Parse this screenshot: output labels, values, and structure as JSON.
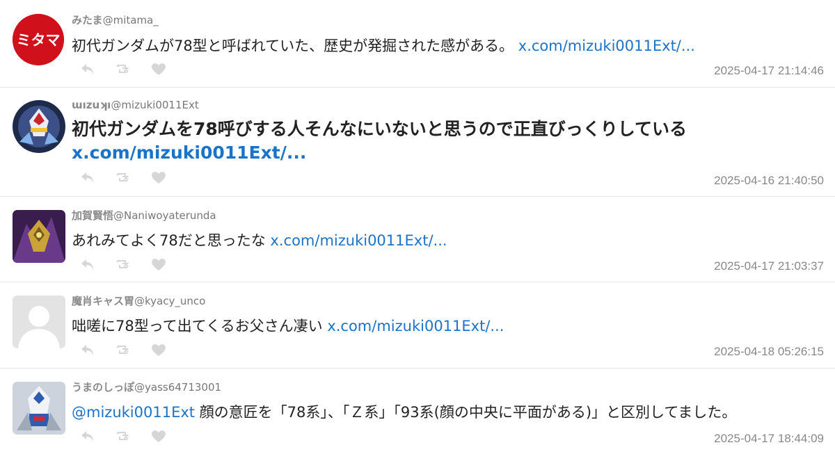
{
  "tweets": [
    {
      "name": "みたま",
      "handle": "@mitama_",
      "avatar_text": "ミタマ",
      "text": "初代ガンダムが78型と呼ばれていた、歴史が発掘された感がある。",
      "link": "x.com/mizuki0011Ext/...",
      "time": "2025-04-17 21:14:46"
    },
    {
      "name": "ɯızuʞı",
      "handle": "@mizuki0011Ext",
      "text": "初代ガンダムを78呼びする人そんなにいないと思うので正直びっくりしている",
      "link": "x.com/mizuki0011Ext/...",
      "time": "2025-04-16 21:40:50"
    },
    {
      "name": "加賀賢悟",
      "handle": "@Naniwoyaterunda",
      "text": "あれみてよく78だと思ったな",
      "link": "x.com/mizuki0011Ext/...",
      "time": "2025-04-17 21:03:37"
    },
    {
      "name": "魔肖キャス胃",
      "handle": "@kyacy_unco",
      "text": "咄嗟に78型って出てくるお父さん凄い",
      "link": "x.com/mizuki0011Ext/...",
      "time": "2025-04-18 05:26:15"
    },
    {
      "name": "うまのしっぽ",
      "handle": "@yass64713001",
      "mention": "@mizuki0011Ext",
      "text": "顔の意匠を「78系」、「Ｚ系」「93系(顔の中央に平面がある)」と区別してました。",
      "time": "2025-04-17 18:44:09"
    }
  ],
  "icons": {
    "reply": "reply-icon",
    "retweet": "retweet-icon",
    "like": "heart-icon"
  },
  "colors": {
    "link": "#1a73c8",
    "icon": "#d6d6d6",
    "avatar_red": "#d0101a",
    "divider": "#e8e8e8"
  }
}
